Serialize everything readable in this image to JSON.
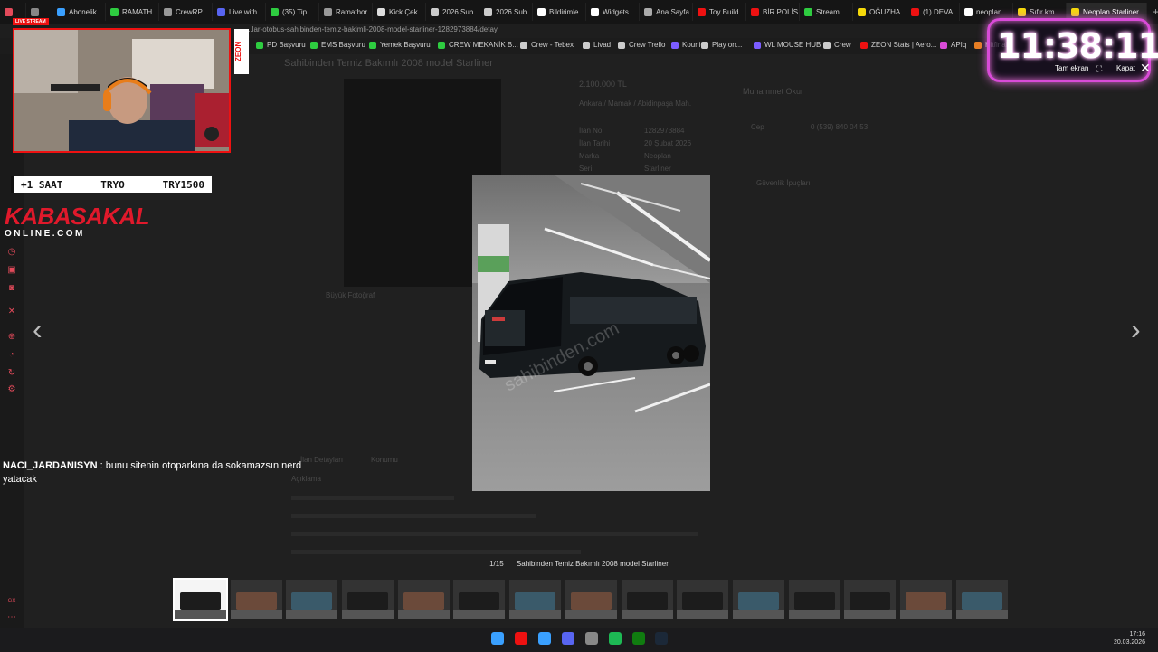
{
  "browser": {
    "tabs": [
      {
        "label": "",
        "color": "#e24a5a"
      },
      {
        "label": "",
        "color": "#888888"
      },
      {
        "label": "Abonelik",
        "color": "#3aa0ff"
      },
      {
        "label": "RAMATH",
        "color": "#2ecc40"
      },
      {
        "label": "CrewRP",
        "color": "#999999"
      },
      {
        "label": "Live with",
        "color": "#5865f2"
      },
      {
        "label": "(35) Tip",
        "color": "#2ecc40"
      },
      {
        "label": "Ramathor",
        "color": "#999999"
      },
      {
        "label": "Kick Çek",
        "color": "#dddddd"
      },
      {
        "label": "2026 Sub",
        "color": "#cccccc"
      },
      {
        "label": "2026 Sub",
        "color": "#cccccc"
      },
      {
        "label": "Bildirimle",
        "color": "#ffffff"
      },
      {
        "label": "Widgets",
        "color": "#ffffff"
      },
      {
        "label": "Ana Sayfa",
        "color": "#aaaaaa"
      },
      {
        "label": "Toy Build",
        "color": "#e11"
      },
      {
        "label": "BİR POLİS",
        "color": "#e11"
      },
      {
        "label": "Stream",
        "color": "#2ecc40"
      },
      {
        "label": "OĞUZHA",
        "color": "#f5d90a"
      },
      {
        "label": "(1) DEVA",
        "color": "#e11"
      },
      {
        "label": "neoplan",
        "color": "#ffffff"
      },
      {
        "label": "Sıfır km",
        "color": "#f5d90a"
      },
      {
        "label": "Neoplan Starliner",
        "color": "#f5d90a",
        "active": true
      }
    ],
    "new_tab": "+",
    "url": "...lar-otobus-sahibinden-temiz-bakimli-2008-model-starliner-1282973884/detay",
    "bookmarks": [
      {
        "label": "PD Başvuru",
        "color": "#2ecc40"
      },
      {
        "label": "EMS Başvuru",
        "color": "#2ecc40"
      },
      {
        "label": "Yemek Başvuru",
        "color": "#2ecc40"
      },
      {
        "label": "CREW MEKANİK B...",
        "color": "#2ecc40"
      },
      {
        "label": "Crew - Tebex",
        "color": "#cccccc"
      },
      {
        "label": "Livad",
        "color": "#cccccc"
      },
      {
        "label": "Crew Trello",
        "color": "#cccccc"
      },
      {
        "label": "Kour.io",
        "color": "#7b5cff"
      },
      {
        "label": "Play on...",
        "color": "#cccccc"
      },
      {
        "label": "WL MOUSE HUB",
        "color": "#7b5cff"
      },
      {
        "label": "Crew",
        "color": "#cccccc"
      },
      {
        "label": "ZEON Stats | Aero...",
        "color": "#e11"
      },
      {
        "label": "APIq",
        "color": "#d94bd8"
      },
      {
        "label": "Hitfinal...",
        "color": "#e67e22"
      }
    ]
  },
  "listing_background": {
    "title": "Sahibinden Temiz Bakımlı 2008 model Starliner",
    "price": "2.100.000 TL",
    "location": "Ankara / Mamak / Abidinpaşa Mah.",
    "fields": [
      {
        "k": "İlan No",
        "v": "1282973884"
      },
      {
        "k": "İlan Tarihi",
        "v": "20 Şubat 2026"
      },
      {
        "k": "Marka",
        "v": "Neoplan"
      },
      {
        "k": "Seri",
        "v": "Starliner"
      }
    ],
    "seller": "Muhammet Okur",
    "phone_label": "Cep",
    "phone": "0 (539) 840 04 53",
    "safe_title": "Güvenlik İpuçları",
    "tabs": [
      "İlan Detayları",
      "Konumu"
    ],
    "desc_title": "Açıklama",
    "big_photo": "Büyük Fotoğraf"
  },
  "viewer": {
    "counter": "1/15",
    "caption": "Sahibinden Temiz Bakımlı 2008 model Starliner",
    "watermark": "sahibinden.com",
    "thumb_count": 15,
    "active_index": 0,
    "prev": "‹",
    "next": "›"
  },
  "stream": {
    "live_tag": "LIVE STREAM",
    "zeon": "ZEON",
    "goal": {
      "left": "+1 SAAT",
      "mid": "TRYO",
      "right": "TRY1500"
    },
    "brand_main": "KABASAKAL",
    "brand_sub": "ONLINE.COM",
    "chat_user": "NACI_JARDANISYN",
    "chat_msg": " : bunu sitenin otoparkına da sokamazsın nerd yatacak",
    "timer": "11:38:11",
    "timer_fullscreen": "Tam ekran",
    "timer_close": "Kapat"
  },
  "taskbar": {
    "time": "17:16",
    "date": "20.03.2026",
    "icons": [
      {
        "name": "windows-start",
        "color": "#3aa0ff"
      },
      {
        "name": "opera",
        "color": "#e11"
      },
      {
        "name": "app-blue",
        "color": "#3aa0ff"
      },
      {
        "name": "discord",
        "color": "#5865f2"
      },
      {
        "name": "app-grey",
        "color": "#888888"
      },
      {
        "name": "spotify",
        "color": "#1db954"
      },
      {
        "name": "xbox",
        "color": "#107c10"
      },
      {
        "name": "steam",
        "color": "#1b2838"
      }
    ]
  }
}
